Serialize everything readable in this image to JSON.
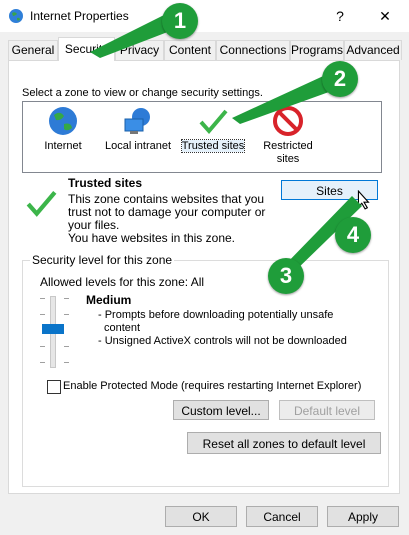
{
  "window": {
    "title": "Internet Properties",
    "help": "?",
    "close": "✕"
  },
  "tabs": [
    "General",
    "Security",
    "Privacy",
    "Content",
    "Connections",
    "Programs",
    "Advanced"
  ],
  "active_tab": "Security",
  "zone_prompt": "Select a zone to view or change security settings.",
  "zones": [
    {
      "label": "Internet"
    },
    {
      "label": "Local intranet"
    },
    {
      "label": "Trusted sites"
    },
    {
      "label": "Restricted sites"
    }
  ],
  "selected_zone": {
    "name": "Trusted sites",
    "desc1": "This zone contains websites that you",
    "desc2": "trust not to damage your computer or",
    "desc3": "your files.",
    "desc4": "You have websites in this zone."
  },
  "sites_button": "Sites",
  "security_level": {
    "group_title": "Security level for this zone",
    "allowed": "Allowed levels for this zone: All",
    "level_name": "Medium",
    "bullet1": "- Prompts before downloading potentially unsafe",
    "bullet1b": "content",
    "bullet2": "- Unsigned ActiveX controls will not be downloaded",
    "protected_mode": "Enable Protected Mode (requires restarting Internet Explorer)",
    "custom_level": "Custom level...",
    "default_level": "Default level"
  },
  "reset_all": "Reset all zones to default level",
  "footer": {
    "ok": "OK",
    "cancel": "Cancel",
    "apply": "Apply"
  },
  "annotations": [
    "1",
    "2",
    "3",
    "4"
  ],
  "colors": {
    "accent": "#0078d7",
    "annotation_green": "#1f9d3a",
    "panel": "#ffffff",
    "chrome": "#f0f0f0"
  }
}
